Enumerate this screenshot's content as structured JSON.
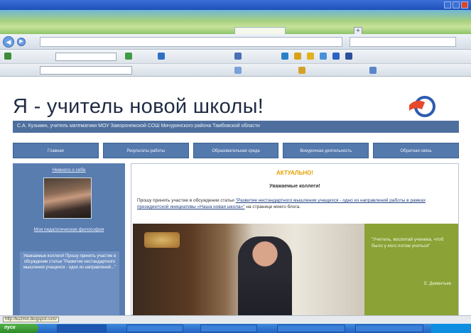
{
  "page": {
    "site_title": "Я - учитель новой  школы!",
    "subtitle": "С.А. Кузьмин, учитель математики МОУ Заворонежской СОШ Мичуринского района Тамбовской области",
    "menu": [
      "Главная",
      "Результаты работы",
      "Образовательная среда",
      "Внеурочная деятельность",
      "Обратная связь"
    ],
    "sidebar": {
      "about_link": "Немного о себе",
      "philosophy_link": "Моя педагогическая философия",
      "news": "Уважаемые коллеги! Прошу принять участие в обсуждении статьи \"Развитие нестандартного мышления учащихся - одно из направлений...\""
    },
    "announcement": {
      "title": "АКТУАЛЬНО!",
      "greeting": "Уважаемые коллеги!",
      "body_prefix": "Прошу принять участие в обсуждении статьи ",
      "body_link": "\"Развитие нестандартного мышления учащихся - одно из направлений работы в рамках президентской инициативы «Наша новая школа»\"",
      "body_suffix": " на странице моего блога."
    },
    "quote": {
      "text": "\"Учитель, воспитай ученика, чтоб было у кого потом учиться\"",
      "author": "Е. Дементьев"
    }
  },
  "statusbar": {
    "tip": "http://kuzmin.blogspot.com/"
  },
  "taskbar": {
    "start": "пуск"
  },
  "colors": {
    "title_bar": "#2a5cc6",
    "banner": "#4e6f9e",
    "menu": "#5479ad",
    "sidebar": "#5a7db0",
    "accent_orange": "#e5a100",
    "quote_green": "#8aa236"
  }
}
